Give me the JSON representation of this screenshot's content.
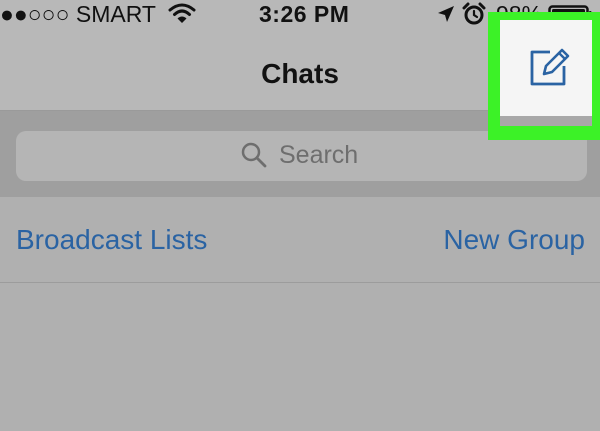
{
  "status_bar": {
    "carrier": "●●○○○ SMART",
    "time": "3:26 PM",
    "battery": "98%",
    "icons": [
      "wifi-icon",
      "location-arrow-icon",
      "alarm-icon",
      "battery-icon"
    ]
  },
  "nav": {
    "title": "Chats",
    "compose_icon": "compose-icon"
  },
  "search": {
    "placeholder": "Search",
    "icon": "search-icon"
  },
  "actions": {
    "broadcast_lists": "Broadcast Lists",
    "new_group": "New Group"
  },
  "colors": {
    "link": "#2a63a3",
    "highlight": "#3cf227",
    "dim_background": "#b0b0b0"
  }
}
